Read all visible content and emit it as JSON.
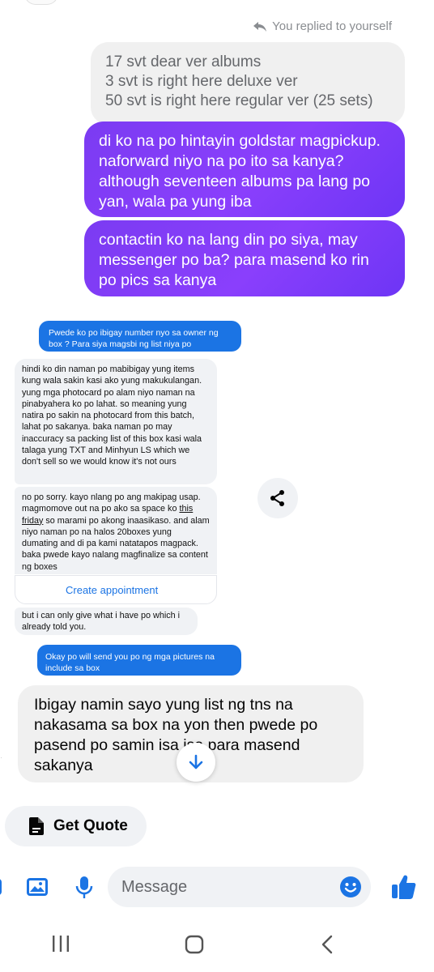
{
  "header": {
    "replied_text": "You replied to yourself"
  },
  "quoted_message": {
    "lines": [
      "17 svt dear ver albums",
      "3 svt is right here deluxe ver",
      "50 svt is right here regular ver (25 sets)"
    ]
  },
  "outgoing_messages": [
    {
      "text": "di ko na po hintayin goldstar magpickup. naforward niyo na po ito sa kanya? although seventeen albums pa lang po yan, wala pa yung iba"
    },
    {
      "text": "contactin ko na lang din po siya, may messenger po ba? para masend ko rin po pics sa kanya"
    }
  ],
  "screenshot_embed": {
    "outgoing_1": "Pwede ko po ibigay number nyo sa owner ng box ? Para siya magsbi ng list niya po",
    "incoming_1": "hindi ko din naman po mabibigay yung items kung wala sakin kasi ako yung makukulangan. yung mga photocard po alam niyo naman na pinabyahera ko po lahat. so meaning yung natira po sakin na photocard from this batch, lahat po sakanya. baka naman po may inaccuracy sa packing list of this box kasi wala talaga yung TXT and Minhyun LS which we don't sell so we would know it's not ours",
    "incoming_2_before": "no po sorry. kayo nlang po ang makipag usap. magmomove out na po ako sa space ko ",
    "incoming_2_link": "this friday",
    "incoming_2_after": " so marami po akong inaasikaso. and alam niyo naman po na halos 20boxes yung dumating and di pa kami natatapos magpack. baka pwede kayo nalang magfinalize sa content ng boxes",
    "appointment_label": "Create appointment",
    "incoming_3": "but i can only give what i have po which i already told you.",
    "outgoing_2": "Okay po will send you po ng mga pictures na include sa box"
  },
  "incoming_message": {
    "text": "Ibigay namin sayo yung list ng tns na nakasama sa box na yon then pwede po pasend po samin isa isa para masend sakanya"
  },
  "quick_reply": {
    "label": "Get Quote"
  },
  "composer": {
    "placeholder": "Message"
  },
  "colors": {
    "accent": "#1b74e4",
    "purple": "#7b3bf2",
    "bubble_gray": "#f0f0f0"
  },
  "icons": [
    "reply-arrow-icon",
    "share-icon",
    "arrow-down-icon",
    "document-icon",
    "image-icon",
    "mic-icon",
    "emoji-icon",
    "thumbs-up-icon",
    "recent-apps-icon",
    "home-icon",
    "back-icon"
  ]
}
